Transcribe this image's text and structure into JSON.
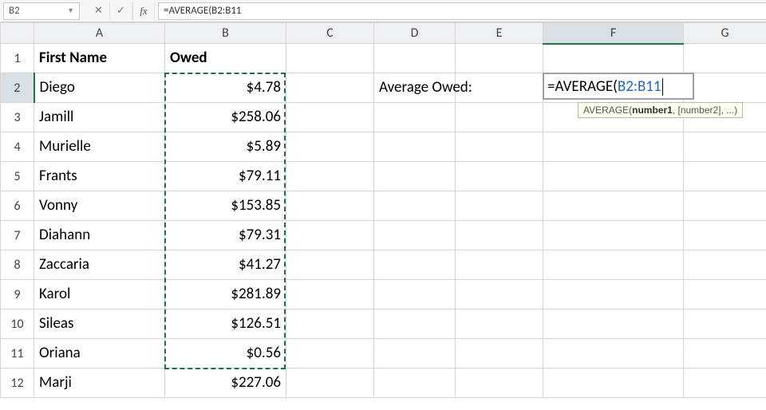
{
  "namebox": {
    "value": "B2"
  },
  "formula_bar": {
    "value": "=AVERAGE(B2:B11"
  },
  "column_headers": [
    "A",
    "B",
    "C",
    "D",
    "E",
    "F",
    "G"
  ],
  "row_headers": [
    "1",
    "2",
    "3",
    "4",
    "5",
    "6",
    "7",
    "8",
    "9",
    "10",
    "11",
    "12"
  ],
  "headers": {
    "colA": "First Name",
    "colB": "Owed"
  },
  "rows": [
    {
      "name": "Diego",
      "owed": "$4.78"
    },
    {
      "name": "Jamill",
      "owed": "$258.06"
    },
    {
      "name": "Murielle",
      "owed": "$5.89"
    },
    {
      "name": "Frants",
      "owed": "$79.11"
    },
    {
      "name": "Vonny",
      "owed": "$153.85"
    },
    {
      "name": "Diahann",
      "owed": "$79.31"
    },
    {
      "name": "Zaccaria",
      "owed": "$41.27"
    },
    {
      "name": "Karol",
      "owed": "$281.89"
    },
    {
      "name": "Sileas",
      "owed": "$126.51"
    },
    {
      "name": "Oriana",
      "owed": "$0.56"
    },
    {
      "name": "Marji",
      "owed": "$227.06"
    }
  ],
  "label_D2": "Average Owed:",
  "editing_cell": {
    "prefix": "=AVERAGE(",
    "ref": "B2:B11"
  },
  "tooltip": {
    "fn": "AVERAGE(",
    "arg1": "number1",
    "rest": ", [number2], ...)"
  }
}
